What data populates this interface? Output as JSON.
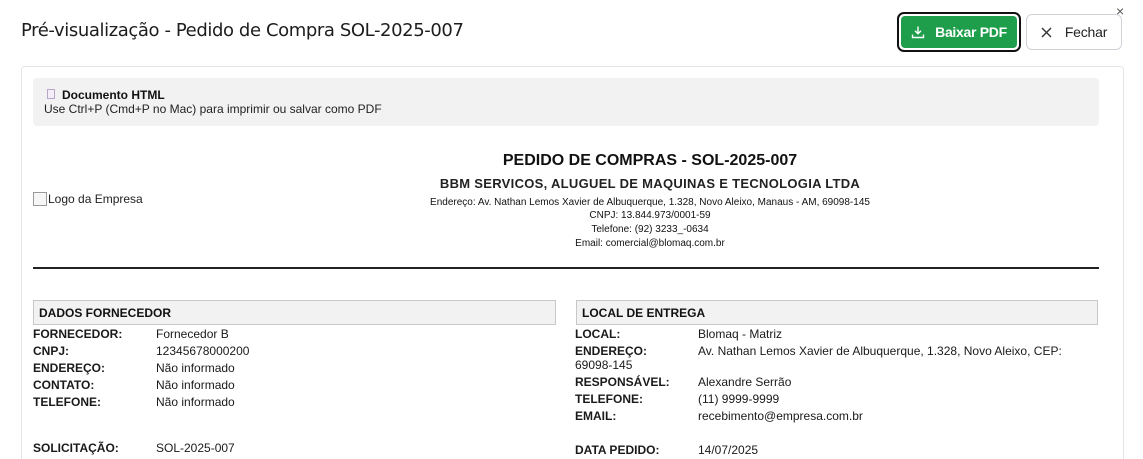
{
  "dialog": {
    "title": "Pré-visualização - Pedido de Compra SOL-2025-007",
    "download_label": "Baixar PDF",
    "close_label": "Fechar",
    "corner_close": "×",
    "icons": {
      "download": "download-icon",
      "close": "close-icon"
    },
    "accent_color": "#1e9e4a"
  },
  "notice": {
    "title": "Documento HTML",
    "text": "Use Ctrl+P (Cmd+P no Mac) para imprimir ou salvar como PDF"
  },
  "company": {
    "logo_alt": "Logo da Empresa",
    "doc_title": "PEDIDO DE COMPRAS - SOL-2025-007",
    "name": "BBM SERVICOS, ALUGUEL DE MAQUINAS E TECNOLOGIA LTDA",
    "address": "Endereço: Av. Nathan Lemos Xavier de Albuquerque, 1.328, Novo Aleixo, Manaus - AM, 69098-145",
    "cnpj": "CNPJ: 13.844.973/0001-59",
    "phone": "Telefone: (92) 3233_-0634",
    "email": "Email: comercial@blomaq.com.br"
  },
  "supplier": {
    "heading": "DADOS FORNECEDOR",
    "rows": [
      {
        "k": "FORNECEDOR:",
        "v": "Fornecedor B"
      },
      {
        "k": "CNPJ:",
        "v": "12345678000200"
      },
      {
        "k": "ENDEREÇO:",
        "v": "Não informado"
      },
      {
        "k": "CONTATO:",
        "v": "Não informado"
      },
      {
        "k": "TELEFONE:",
        "v": "Não informado"
      }
    ],
    "request_label": "SOLICITAÇÃO:",
    "request_value": "SOL-2025-007"
  },
  "delivery": {
    "heading": "LOCAL DE ENTREGA",
    "local_k": "LOCAL:",
    "local_v": "Blomaq - Matriz",
    "addr_k": "ENDEREÇO:",
    "addr_v": "Av. Nathan Lemos Xavier de Albuquerque, 1.328, Novo Aleixo, CEP:",
    "addr_v2": "69098-145",
    "resp_k": "RESPONSÁVEL:",
    "resp_v": "Alexandre Serrão",
    "tel_k": "TELEFONE:",
    "tel_v": "(11) 9999-9999",
    "email_k": "EMAIL:",
    "email_v": "recebimento@empresa.com.br",
    "date_label": "DATA PEDIDO:",
    "date_value": "14/07/2025"
  }
}
